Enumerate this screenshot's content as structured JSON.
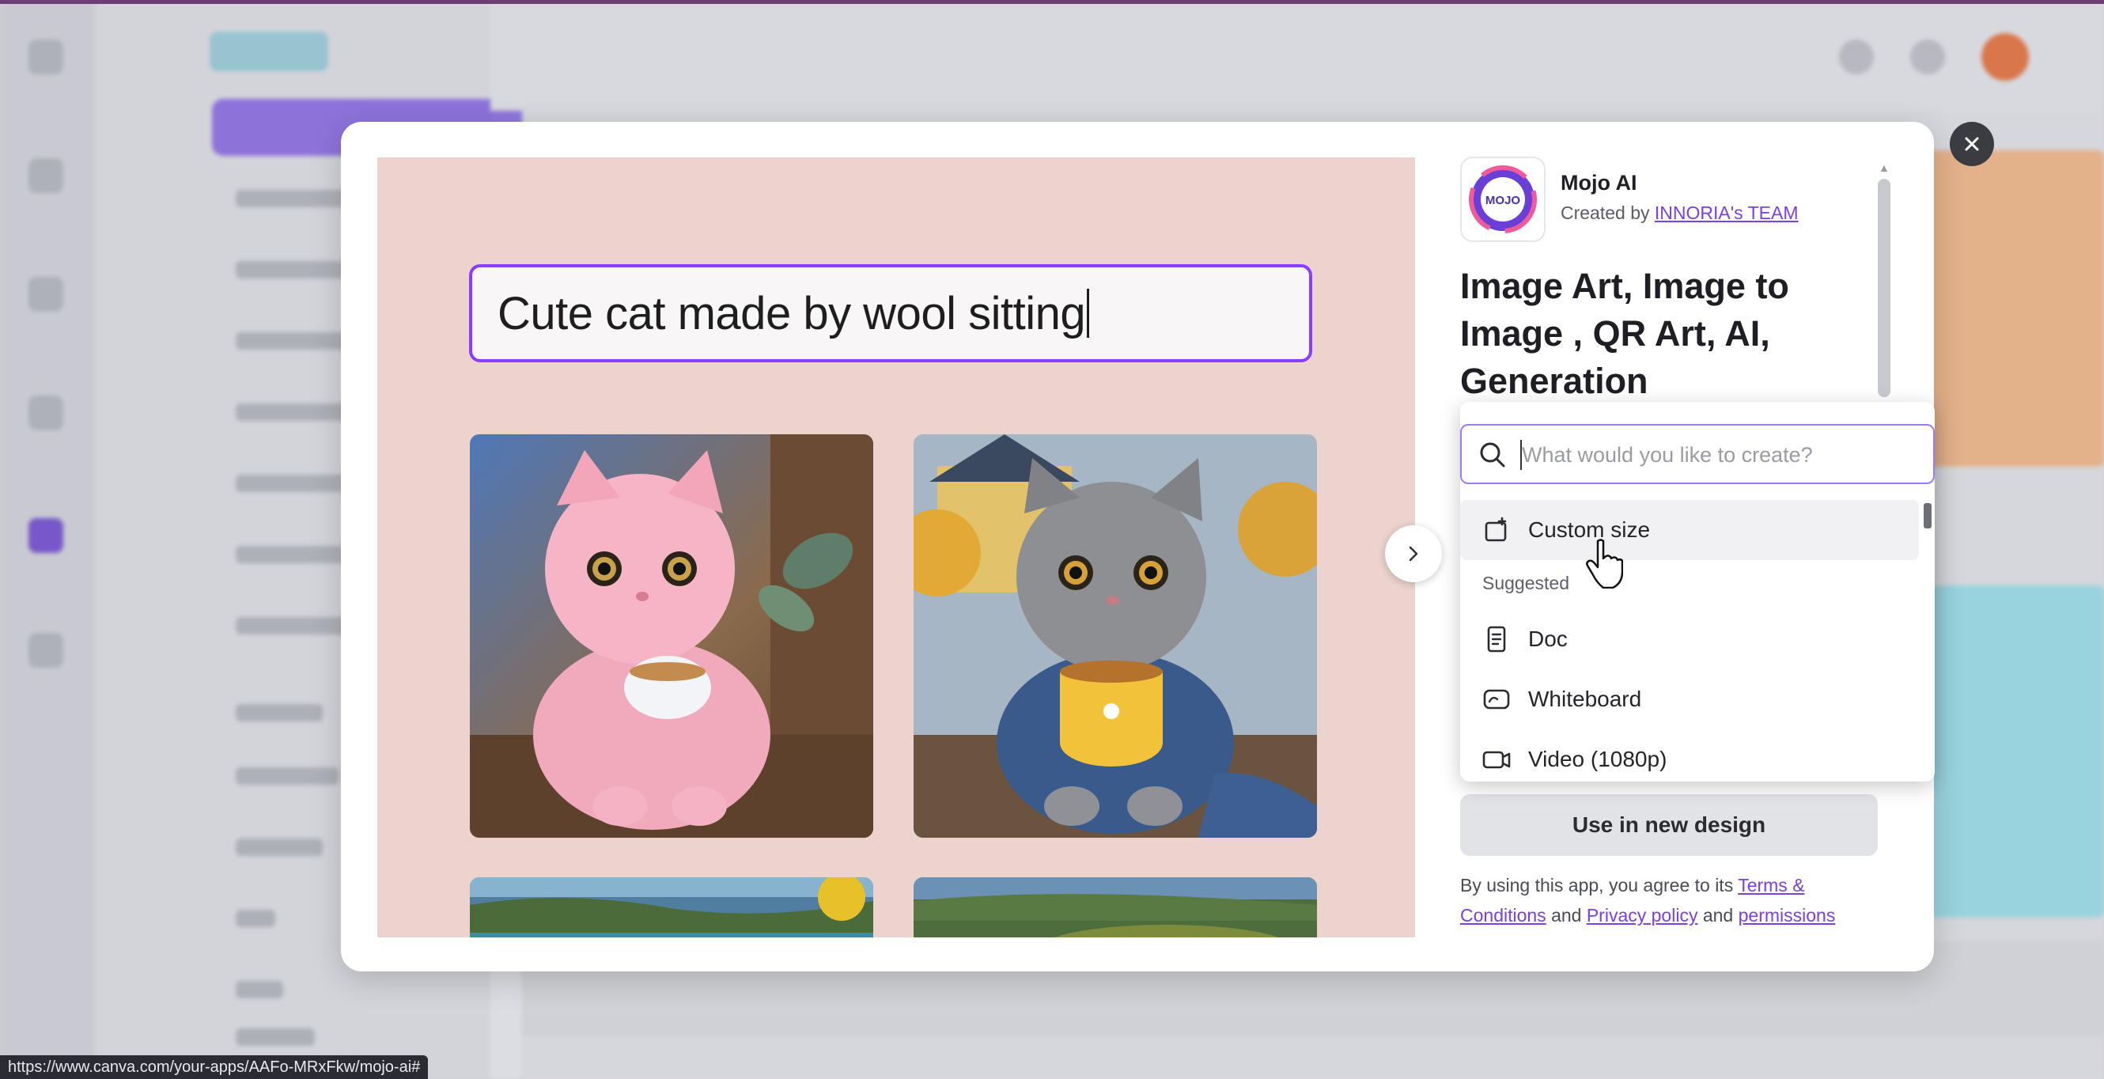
{
  "status_bar": {
    "url": "https://www.canva.com/your-apps/AAFo-MRxFkw/mojo-ai#"
  },
  "modal": {
    "close_label": "✕",
    "preview": {
      "prompt": "Cute cat made by wool sitting",
      "images": [
        "pink-wool-cat-with-teacup",
        "gray-wool-cat-with-yellow-mug",
        "lake-landscape",
        "green-landscape"
      ]
    },
    "app": {
      "icon_text": "MOJO",
      "name": "Mojo AI",
      "created_by_prefix": "Created by",
      "created_by_link": "INNORIA's TEAM",
      "title": "Image Art, Image to Image , QR Art, AI, Generation"
    },
    "dropdown": {
      "search_placeholder": "What would you like to create?",
      "search_value": "",
      "custom_size_label": "Custom size",
      "section_label": "Suggested",
      "items": [
        {
          "label": "Doc",
          "icon": "doc-icon"
        },
        {
          "label": "Whiteboard",
          "icon": "whiteboard-icon"
        },
        {
          "label": "Video (1080p)",
          "icon": "video-icon"
        }
      ]
    },
    "use_button_label": "Use in new design",
    "terms": {
      "prefix": "By using this app, you agree to its",
      "terms_link": "Terms & Conditions",
      "and1": "and",
      "privacy_link": "Privacy policy",
      "and2": "and",
      "permissions_link": "permissions"
    }
  }
}
